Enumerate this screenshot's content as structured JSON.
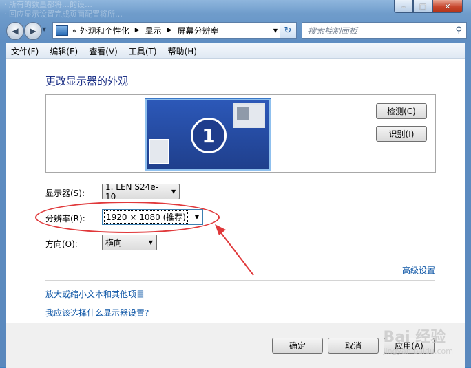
{
  "background_text": [
    "· 所有的数量都将…的设…",
    "· 回应显示设置完成页面配置将所…"
  ],
  "window": {
    "minimize_icon": "minimize-icon",
    "maximize_icon": "maximize-icon",
    "close_icon": "close-icon"
  },
  "nav": {
    "back_icon": "back-arrow-icon",
    "forward_icon": "forward-arrow-icon",
    "address": {
      "prefix": "«",
      "segments": [
        "外观和个性化",
        "显示",
        "屏幕分辨率"
      ]
    },
    "search_placeholder": "搜索控制面板"
  },
  "menu": [
    "文件(F)",
    "编辑(E)",
    "查看(V)",
    "工具(T)",
    "帮助(H)"
  ],
  "page": {
    "title": "更改显示器的外观",
    "monitor_number": "1",
    "detect_button": "检测(C)",
    "identify_button": "识别(I)",
    "display_label": "显示器(S):",
    "display_value": "1. LEN S24e-10",
    "resolution_label": "分辨率(R):",
    "resolution_value": "1920 × 1080 (推荐)",
    "orientation_label": "方向(O):",
    "orientation_value": "横向",
    "advanced_link": "高级设置",
    "link_text_size": "放大或缩小文本和其他项目",
    "link_which_settings": "我应该选择什么显示器设置?",
    "ok_button": "确定",
    "cancel_button": "取消",
    "apply_button": "应用(A)"
  },
  "annotation": {
    "color": "#e0383a"
  },
  "watermark": {
    "text": "Bai 经验",
    "sub": "jingyan.baidu.com"
  }
}
